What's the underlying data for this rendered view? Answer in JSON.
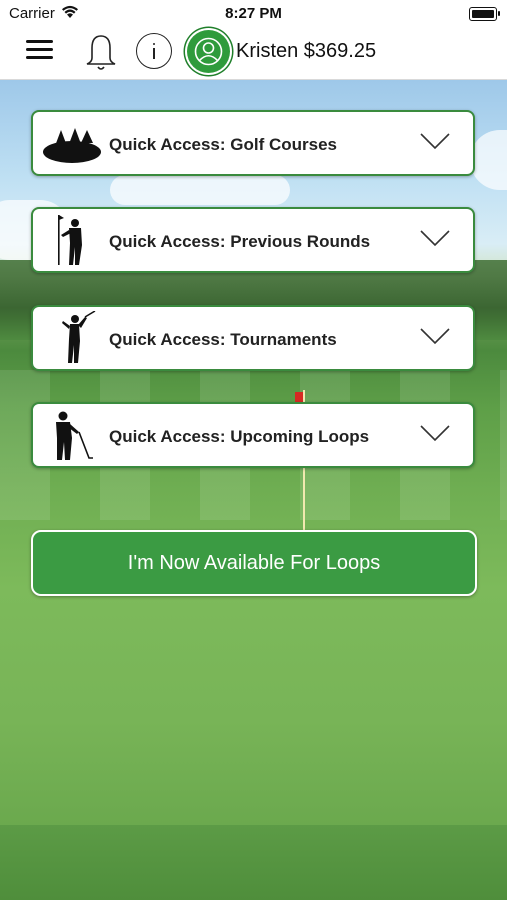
{
  "status_bar": {
    "carrier": "Carrier",
    "time": "8:27 PM"
  },
  "nav": {
    "icons": [
      "menu-icon",
      "bell-icon",
      "info-icon",
      "avatar-icon"
    ],
    "user_label": "Kristen $369.25"
  },
  "quick_access": [
    {
      "label": "Quick Access: Golf Courses",
      "icon": "golf-course-icon"
    },
    {
      "label": "Quick Access: Previous Rounds",
      "icon": "golfer-standing-icon"
    },
    {
      "label": "Quick Access: Tournaments",
      "icon": "golfer-swing-icon"
    },
    {
      "label": "Quick Access: Upcoming Loops",
      "icon": "caddie-icon"
    }
  ],
  "cta": {
    "label": "I'm Now Available For Loops"
  },
  "colors": {
    "accent_green": "#3b9b43",
    "card_border": "#3a8b3e"
  }
}
